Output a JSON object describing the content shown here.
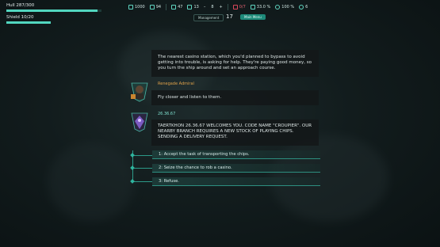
{
  "status": {
    "hull_label": "Hull 287/300",
    "hull_fraction": 0.957,
    "shield_label": "Shield 10/20",
    "shield_fraction": 0.5
  },
  "resources": [
    {
      "icon": "credits-icon",
      "value": "1000"
    },
    {
      "icon": "fuel-icon",
      "value": "94"
    },
    {
      "icon": "cargo-icon",
      "value": "47"
    },
    {
      "icon": "crew-icon",
      "value": "13"
    },
    {
      "icon": "minus-icon",
      "value": ""
    },
    {
      "icon": "counter",
      "value": "8"
    },
    {
      "icon": "plus-icon",
      "value": ""
    },
    {
      "icon": "danger-icon",
      "value": "0/7"
    },
    {
      "icon": "reputation-icon",
      "value": "33.0 %"
    },
    {
      "icon": "clock-icon",
      "value": "100 %"
    },
    {
      "icon": "moon-icon",
      "value": "6"
    }
  ],
  "tabs": {
    "management": "Management",
    "main": "Main Menu",
    "day": "17"
  },
  "dialogue": {
    "narration": "The nearest casino station, which you'd planned to bypass to avoid getting into trouble, is asking for help. They're paying good money, so you turn the ship around and set an approach course.",
    "admiral_name": "Renegade Admiral",
    "admiral_line": "Fly closer and listen to them.",
    "bot_name": "26.36.67",
    "bot_line": "TAERTKHON 26.36.67 WELCOMES YOU. CODE NAME \"CROUPIER\". OUR NEARBY BRANCH REQUIRES A NEW STOCK OF PLAYING CHIPS. SENDING A DELIVERY REQUEST."
  },
  "choices": [
    "1: Accept the task of transporting the chips.",
    "2: Seize the chance to rob a casino.",
    "3: Refuse."
  ],
  "colors": {
    "accent": "#2fb59f",
    "admiral": "#e0a24a",
    "danger": "#d9475a"
  }
}
